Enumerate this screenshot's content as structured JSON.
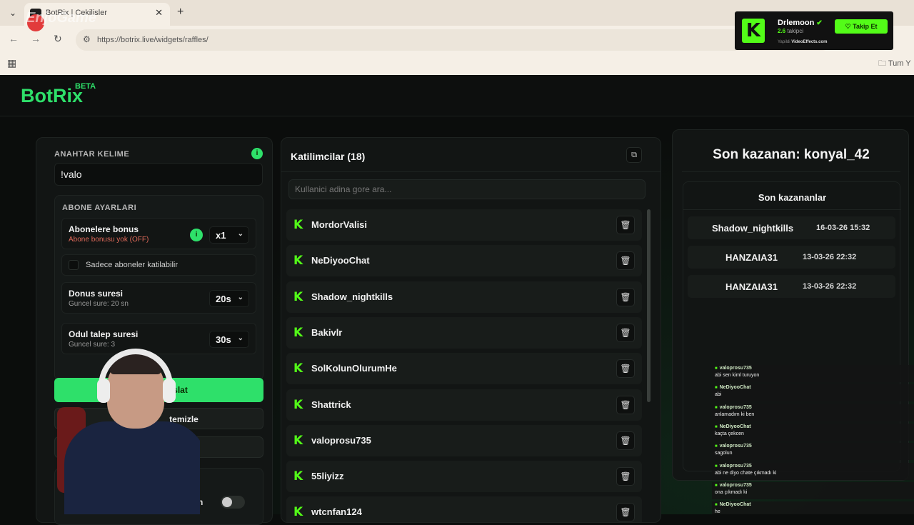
{
  "browser": {
    "tab_title": "BotRix | Cekilisler",
    "url": "https://botrix.live/widgets/raffles/",
    "bookmarks_all": "Tum Y",
    "watermark": "EnjoGame"
  },
  "kick_widget": {
    "name": "Drlemoon",
    "followers_count": "2.6",
    "followers_label": "takipci",
    "follow_label": "Takip Et",
    "credit_prefix": "Yapildi",
    "credit_brand": "VideoEffects.com"
  },
  "app": {
    "logo": "BotRix",
    "logo_badge": "BETA"
  },
  "settings": {
    "keyword_label": "ANAHTAR KELIME",
    "keyword_value": "!valo",
    "subscriber_section": "ABONE AYARLARI",
    "sub_bonus_label": "Abonelere bonus",
    "sub_bonus_sub": "Abone bonusu yok (OFF)",
    "sub_bonus_value": "x1",
    "subs_only_label": "Sadece aboneler katilabilir",
    "duration_label": "Donus suresi",
    "duration_sub": "Guncel sure: 20 sn",
    "duration_value": "20s",
    "claim_label": "Odul talep suresi",
    "claim_sub": "Guncel sure: 3",
    "claim_value": "30s",
    "start_button": "slat",
    "clear_button": "temizle",
    "third_button": "le",
    "bottom_label": "h"
  },
  "participants": {
    "title": "Katilimcilar (18)",
    "search_placeholder": "Kullanici adina gore ara...",
    "items": [
      "MordorValisi",
      "NeDiyooChat",
      "Shadow_nightkills",
      "Bakivlr",
      "SolKolunOlurumHe",
      "Shattrick",
      "valoprosu735",
      "55liyizz",
      "wtcnfan124"
    ]
  },
  "winners": {
    "last_winner": "Son kazanan: konyal_42",
    "list_title": "Son kazananlar",
    "items": [
      {
        "name": "Shadow_nightkills",
        "date": "16-03-26 15:32"
      },
      {
        "name": "HANZAIA31",
        "date": "13-03-26 22:32"
      },
      {
        "name": "HANZAIA31",
        "date": "13-03-26 22:32"
      }
    ]
  },
  "chat": [
    {
      "user": "valoprosu735",
      "msg": "abi sen kiml turuyon"
    },
    {
      "user": "NeDiyooChat",
      "msg": "abi"
    },
    {
      "user": "valoprosu735",
      "msg": "anlamadım ki ben"
    },
    {
      "user": "NeDiyooChat",
      "msg": "kaçta çekcen"
    },
    {
      "user": "valoprosu735",
      "msg": "sagolun"
    },
    {
      "user": "valoprosu735",
      "msg": "abi ne diyo chate çıkmadı ki"
    },
    {
      "user": "valoprosu735",
      "msg": "ona çıkmadı ki"
    },
    {
      "user": "NeDiyooChat",
      "msg": "he"
    }
  ],
  "colors": {
    "accent": "#2ee06a",
    "kick_green": "#53fc18",
    "background": "#0b0d0c",
    "panel": "#121514"
  }
}
